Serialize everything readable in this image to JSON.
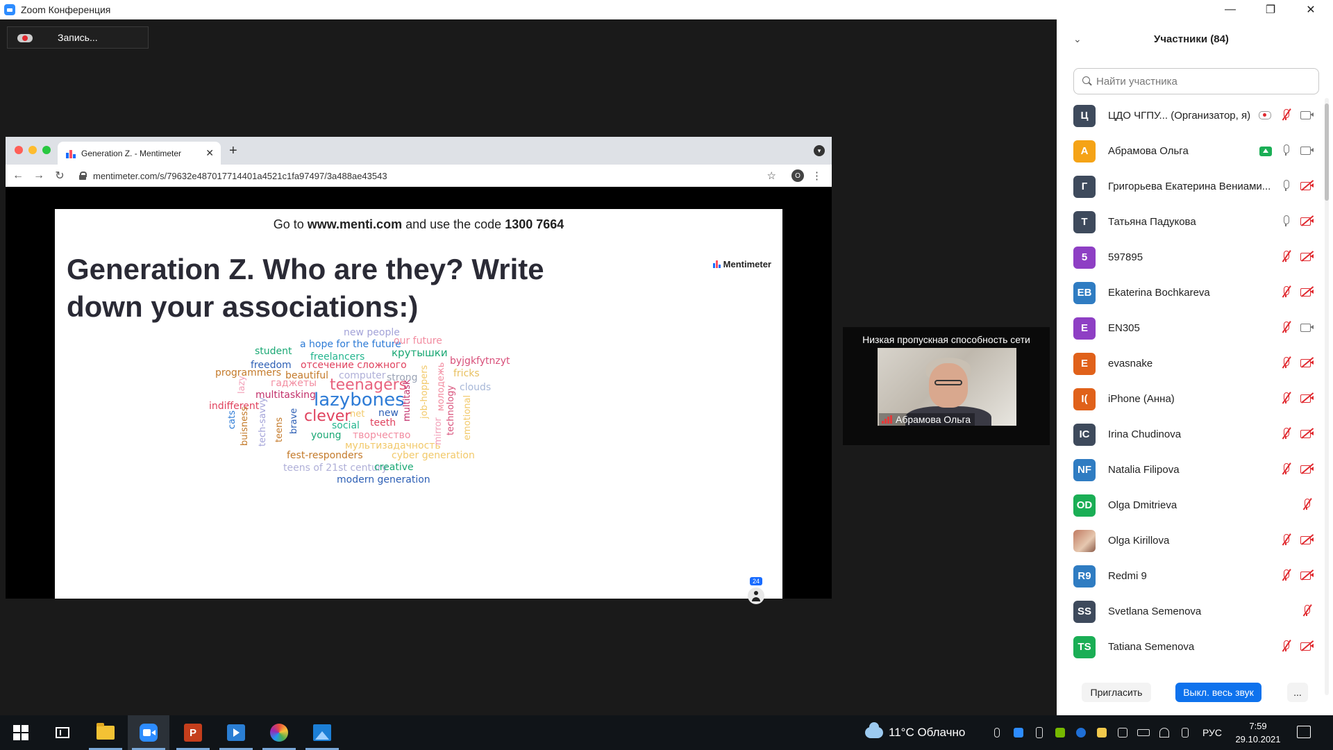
{
  "window": {
    "title": "Zoom Конференция",
    "minimize": "—",
    "restore": "❐",
    "close": "✕"
  },
  "recording": {
    "label": "Запись..."
  },
  "browser": {
    "tab_title": "Generation Z. - Mentimeter",
    "tab_close": "✕",
    "new_tab": "+",
    "url": "mentimeter.com/s/79632e487017714401a4521c1fa97497/3a488ae43543",
    "back": "←",
    "forward": "→",
    "reload": "↻",
    "star": "☆",
    "menu": "⋮",
    "ext_badge": "O",
    "tab_search": "▾"
  },
  "slide": {
    "goto_prefix": "Go to ",
    "goto_site": "www.menti.com",
    "goto_mid": " and use the code ",
    "goto_code": "1300 7664",
    "title": "Generation Z. Who are they? Write down your associations:)",
    "logo": "Mentimeter",
    "participants_count": "24",
    "words": [
      {
        "text": "new people",
        "color": "#a3a3d8",
        "size": 14
      },
      {
        "text": "a hope for the future",
        "color": "#2d7bd6",
        "size": 14
      },
      {
        "text": "our future",
        "color": "#f28ca0",
        "size": 14
      },
      {
        "text": "student",
        "color": "#1aa874",
        "size": 14
      },
      {
        "text": "крутышки",
        "color": "#1aa874",
        "size": 15
      },
      {
        "text": "freelancers",
        "color": "#23b58e",
        "size": 14
      },
      {
        "text": "byjgkfytnzyt",
        "color": "#d8507a",
        "size": 14
      },
      {
        "text": "freedom",
        "color": "#2d5fb5",
        "size": 14
      },
      {
        "text": "отсечение сложного",
        "color": "#e0425e",
        "size": 14
      },
      {
        "text": "programmers",
        "color": "#c47a2a",
        "size": 14
      },
      {
        "text": "beautiful",
        "color": "#c47a2a",
        "size": 14
      },
      {
        "text": "computer",
        "color": "#b0b0d8",
        "size": 14
      },
      {
        "text": "strong",
        "color": "#9aa3b5",
        "size": 14
      },
      {
        "text": "fricks",
        "color": "#e8c060",
        "size": 14
      },
      {
        "text": "гаджеты",
        "color": "#f28ca0",
        "size": 14
      },
      {
        "text": "teenagers",
        "color": "#e8627e",
        "size": 22
      },
      {
        "text": "clouds",
        "color": "#a8b8d8",
        "size": 14
      },
      {
        "text": "lazy",
        "color": "#f2a0b8",
        "size": 13
      },
      {
        "text": "multitasking",
        "color": "#c2306a",
        "size": 14
      },
      {
        "text": "lazybones",
        "color": "#2d7bd6",
        "size": 26
      },
      {
        "text": "indifferent",
        "color": "#e0425e",
        "size": 14
      },
      {
        "text": "clever",
        "color": "#e0425e",
        "size": 22
      },
      {
        "text": "net",
        "color": "#f2c96a",
        "size": 13
      },
      {
        "text": "new",
        "color": "#2d5fb5",
        "size": 14
      },
      {
        "text": "teeth",
        "color": "#e0425e",
        "size": 14
      },
      {
        "text": "social",
        "color": "#23b58e",
        "size": 14
      },
      {
        "text": "young",
        "color": "#1aa874",
        "size": 14
      },
      {
        "text": "творчество",
        "color": "#f28ca0",
        "size": 14
      },
      {
        "text": "мультизадачность",
        "color": "#f2c96a",
        "size": 14
      },
      {
        "text": "fest-responders",
        "color": "#c47a2a",
        "size": 14
      },
      {
        "text": "cyber generation",
        "color": "#f2c96a",
        "size": 14
      },
      {
        "text": "teens of 21st century",
        "color": "#b0b0d8",
        "size": 14
      },
      {
        "text": "creative",
        "color": "#1aa874",
        "size": 14
      },
      {
        "text": "modern generation",
        "color": "#2d5fb5",
        "size": 14
      },
      {
        "text": "cats",
        "color": "#2d7bd6",
        "size": 13
      },
      {
        "text": "buisness",
        "color": "#c47a2a",
        "size": 13
      },
      {
        "text": "tech-savvy",
        "color": "#a3a3d8",
        "size": 13
      },
      {
        "text": "teens",
        "color": "#c47a2a",
        "size": 13
      },
      {
        "text": "brave",
        "color": "#2d5fb5",
        "size": 13
      },
      {
        "text": "multitask",
        "color": "#c2306a",
        "size": 13
      },
      {
        "text": "job-hoppers",
        "color": "#f2c96a",
        "size": 13
      },
      {
        "text": "молодежь",
        "color": "#f28ca0",
        "size": 13
      },
      {
        "text": "mirror",
        "color": "#f2a0b8",
        "size": 13
      },
      {
        "text": "technology",
        "color": "#d8507a",
        "size": 13
      },
      {
        "text": "emotional",
        "color": "#f2c96a",
        "size": 13
      }
    ]
  },
  "thumbnail": {
    "network_warning": "Низкая пропускная способность сети",
    "name": "Абрамова Ольга"
  },
  "participants": {
    "title": "Участники (84)",
    "collapse_icon": "⌄",
    "search_placeholder": "Найти участника",
    "list": [
      {
        "initials": "Ц",
        "name": "ЦДО ЧГПУ...  (Организатор, я)",
        "color": "#3e4a5c",
        "status": [
          "rec",
          "mic-muted",
          "cam"
        ]
      },
      {
        "initials": "А",
        "name": "Абрамова Ольга",
        "color": "#f5a316",
        "status": [
          "share",
          "mic",
          "cam"
        ]
      },
      {
        "initials": "Г",
        "name": "Григорьева Екатерина Вениами...",
        "color": "#3e4a5c",
        "status": [
          "mic",
          "cam-off"
        ]
      },
      {
        "initials": "Т",
        "name": "Татьяна Падукова",
        "color": "#3e4a5c",
        "status": [
          "mic",
          "cam-off"
        ]
      },
      {
        "initials": "5",
        "name": "597895",
        "color": "#8e3fc4",
        "status": [
          "mic-muted",
          "cam-off"
        ]
      },
      {
        "initials": "EB",
        "name": "Ekaterina Bochkareva",
        "color": "#2f7cc2",
        "status": [
          "mic-muted",
          "cam-off"
        ]
      },
      {
        "initials": "E",
        "name": "EN305",
        "color": "#8e3fc4",
        "status": [
          "mic-muted",
          "cam"
        ]
      },
      {
        "initials": "E",
        "name": "evasnake",
        "color": "#e0611a",
        "status": [
          "mic-muted",
          "cam-off"
        ]
      },
      {
        "initials": "I(",
        "name": "iPhone (Анна)",
        "color": "#e0611a",
        "status": [
          "mic-muted",
          "cam-off"
        ]
      },
      {
        "initials": "IC",
        "name": "Irina Chudinova",
        "color": "#3e4a5c",
        "status": [
          "mic-muted",
          "cam-off"
        ]
      },
      {
        "initials": "NF",
        "name": "Natalia Filipova",
        "color": "#2f7cc2",
        "status": [
          "mic-muted",
          "cam-off"
        ]
      },
      {
        "initials": "OD",
        "name": "Olga Dmitrieva",
        "color": "#1aae55",
        "status": [
          "mic-muted"
        ]
      },
      {
        "initials": "",
        "name": "Olga Kirillova",
        "color": "photo",
        "status": [
          "mic-muted",
          "cam-off"
        ]
      },
      {
        "initials": "R9",
        "name": "Redmi 9",
        "color": "#2f7cc2",
        "status": [
          "mic-muted",
          "cam-off"
        ]
      },
      {
        "initials": "SS",
        "name": "Svetlana Semenova",
        "color": "#3e4a5c",
        "status": [
          "mic-muted"
        ]
      },
      {
        "initials": "TS",
        "name": "Tatiana Semenova",
        "color": "#1aae55",
        "status": [
          "mic-muted",
          "cam-off"
        ]
      }
    ],
    "invite_label": "Пригласить",
    "mute_all_label": "Выкл. весь звук",
    "more_label": "..."
  },
  "taskbar": {
    "weather": "11°C  Облачно",
    "lang": "РУС",
    "time": "7:59",
    "date": "29.10.2021"
  }
}
